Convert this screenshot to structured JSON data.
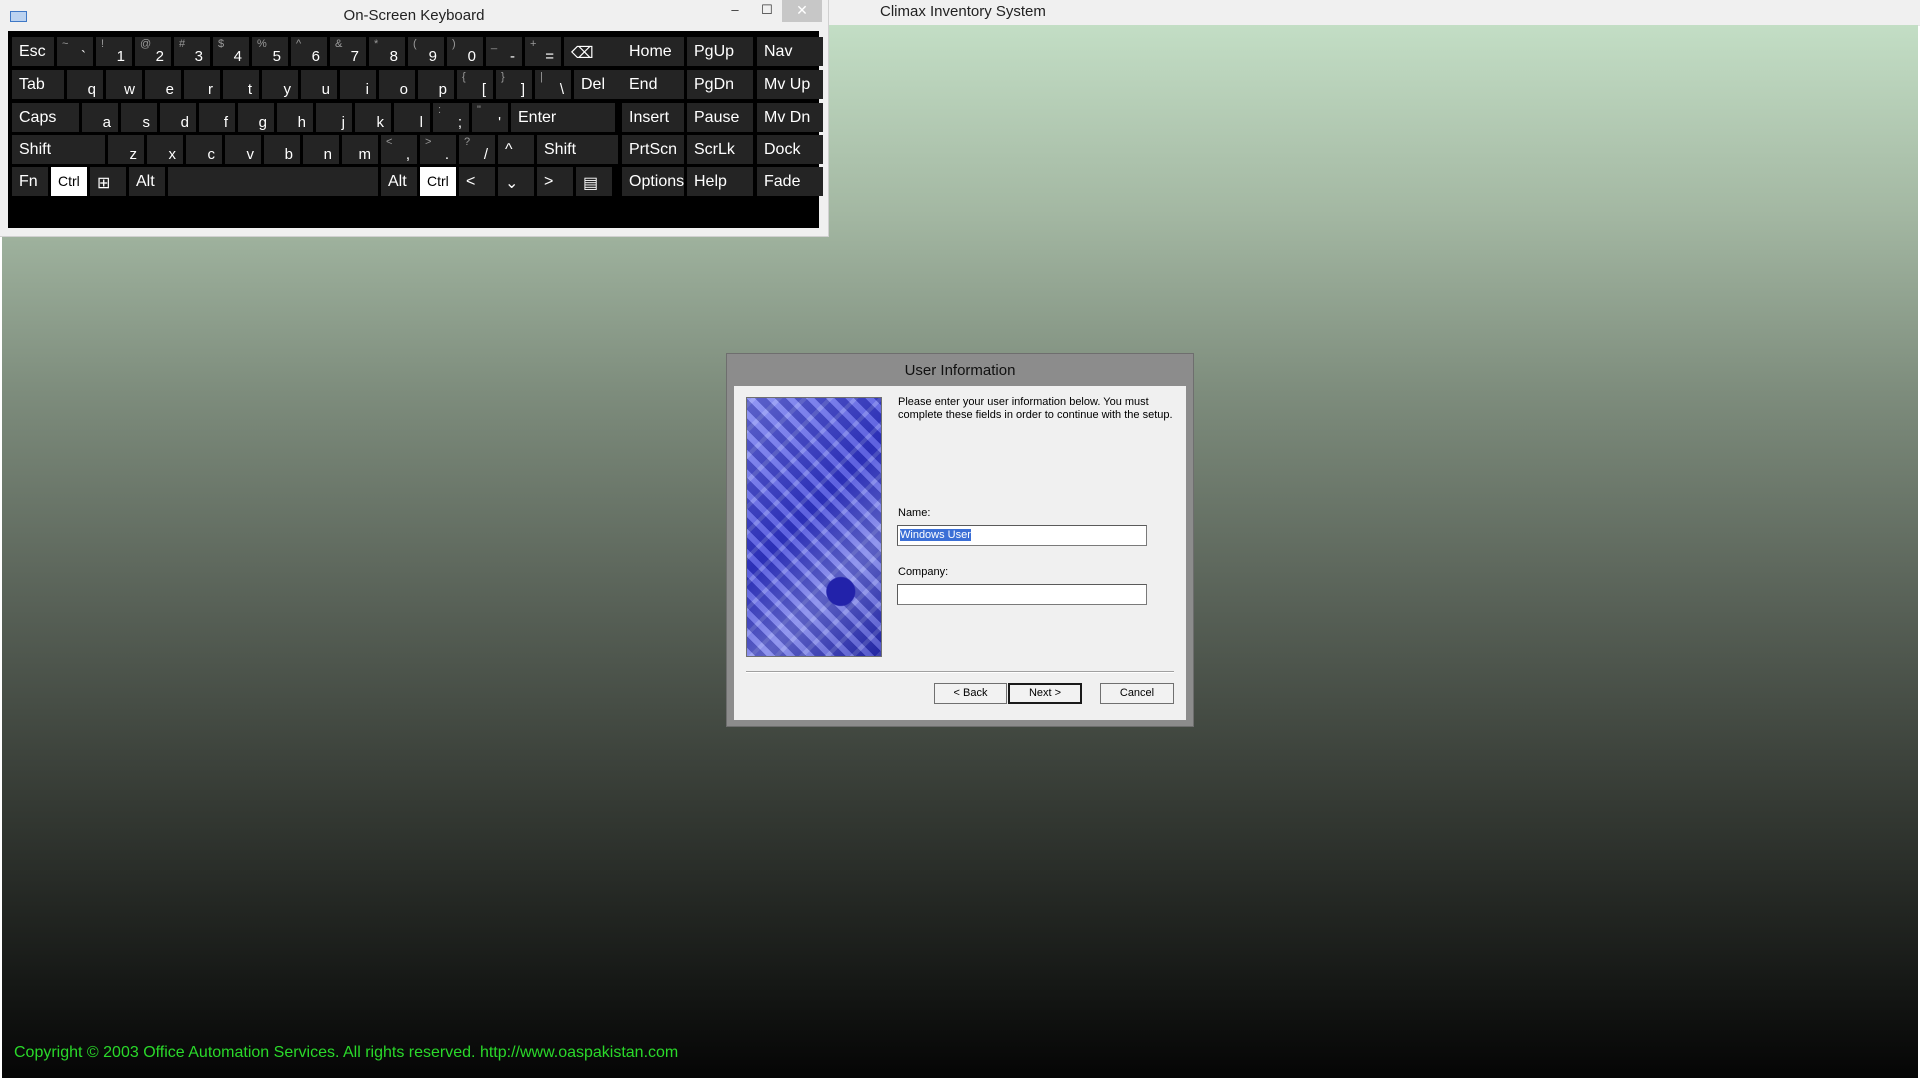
{
  "app": {
    "title": "Climax Inventory System",
    "copyright": "Copyright © 2003 Office Automation Services. All rights reserved. http://www.oaspakistan.com"
  },
  "osk": {
    "title": "On-Screen Keyboard",
    "controls": {
      "minimize": "–",
      "maximize": "☐",
      "close": "✕"
    },
    "keys": [
      {
        "main": "Esc"
      },
      {
        "main": "`",
        "sec": "~"
      },
      {
        "main": "1",
        "sec": "!"
      },
      {
        "main": "2",
        "sec": "@"
      },
      {
        "main": "3",
        "sec": "#"
      },
      {
        "main": "4",
        "sec": "$"
      },
      {
        "main": "5",
        "sec": "%"
      },
      {
        "main": "6",
        "sec": "^"
      },
      {
        "main": "7",
        "sec": "&"
      },
      {
        "main": "8",
        "sec": "*"
      },
      {
        "main": "9",
        "sec": "("
      },
      {
        "main": "0",
        "sec": ")"
      },
      {
        "main": "-",
        "sec": "_"
      },
      {
        "main": "=",
        "sec": "+"
      },
      {
        "main": "⌫"
      },
      {
        "main": "Home"
      },
      {
        "main": "PgUp"
      },
      {
        "main": "Nav"
      },
      {
        "main": "Tab"
      },
      {
        "main": "q"
      },
      {
        "main": "w"
      },
      {
        "main": "e"
      },
      {
        "main": "r"
      },
      {
        "main": "t"
      },
      {
        "main": "y"
      },
      {
        "main": "u"
      },
      {
        "main": "i"
      },
      {
        "main": "o"
      },
      {
        "main": "p"
      },
      {
        "main": "[",
        "sec": "{"
      },
      {
        "main": "]",
        "sec": "}"
      },
      {
        "main": "\\",
        "sec": "|"
      },
      {
        "main": "Del"
      },
      {
        "main": "End"
      },
      {
        "main": "PgDn"
      },
      {
        "main": "Mv Up"
      },
      {
        "main": "Caps"
      },
      {
        "main": "a"
      },
      {
        "main": "s"
      },
      {
        "main": "d"
      },
      {
        "main": "f"
      },
      {
        "main": "g"
      },
      {
        "main": "h"
      },
      {
        "main": "j"
      },
      {
        "main": "k"
      },
      {
        "main": "l"
      },
      {
        "main": ";",
        "sec": ":"
      },
      {
        "main": "'",
        "sec": "\""
      },
      {
        "main": "Enter"
      },
      {
        "main": "Insert"
      },
      {
        "main": "Pause"
      },
      {
        "main": "Mv Dn"
      },
      {
        "main": "Shift"
      },
      {
        "main": "z"
      },
      {
        "main": "x"
      },
      {
        "main": "c"
      },
      {
        "main": "v"
      },
      {
        "main": "b"
      },
      {
        "main": "n"
      },
      {
        "main": "m"
      },
      {
        "main": ",",
        "sec": "<"
      },
      {
        "main": ".",
        "sec": ">"
      },
      {
        "main": "/",
        "sec": "?"
      },
      {
        "main": "^"
      },
      {
        "main": "Shift"
      },
      {
        "main": "PrtScn"
      },
      {
        "main": "ScrLk"
      },
      {
        "main": "Dock"
      },
      {
        "main": "Fn"
      },
      {
        "main": "Ctrl",
        "active": true
      },
      {
        "main": "⊞"
      },
      {
        "main": "Alt"
      },
      {
        "main": ""
      },
      {
        "main": "Alt"
      },
      {
        "main": "Ctrl",
        "active": true
      },
      {
        "main": "<"
      },
      {
        "main": "⌄"
      },
      {
        "main": ">"
      },
      {
        "main": "▤"
      },
      {
        "main": "Options"
      },
      {
        "main": "Help"
      },
      {
        "main": "Fade"
      }
    ]
  },
  "dialog": {
    "title": "User Information",
    "instructions": "Please enter your user information below.  You must complete these fields in order to continue with the setup.",
    "name_label": "Name:",
    "name_value": "Windows User",
    "company_label": "Company:",
    "company_value": "",
    "back_label": "< Back",
    "next_label": "Next >",
    "cancel_label": "Cancel"
  }
}
